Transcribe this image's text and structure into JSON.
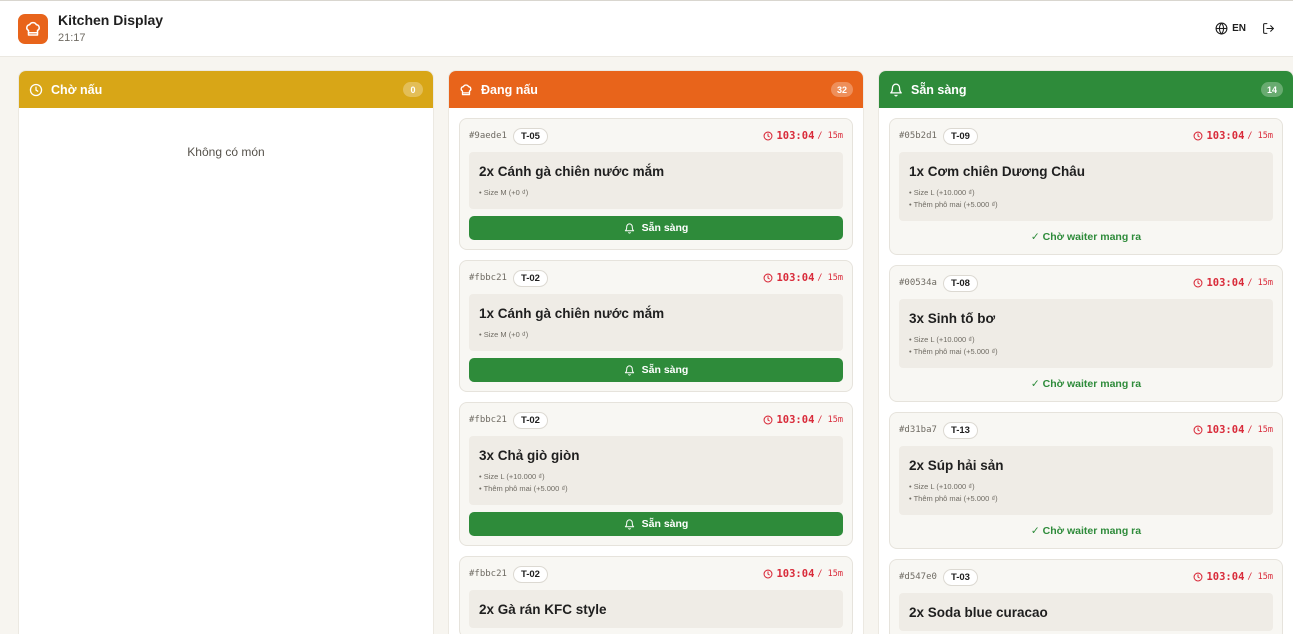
{
  "header": {
    "title": "Kitchen Display",
    "time": "21:17",
    "lang_label": "EN",
    "icons": {
      "logo": "chef-hat-icon",
      "lang": "globe-icon",
      "logout": "logout-icon"
    }
  },
  "colors": {
    "waiting": "#d8a617",
    "cooking": "#e8641b",
    "ready": "#2e8b3a",
    "timer": "#d92b3a"
  },
  "columns": {
    "waiting": {
      "label": "Chờ nấu",
      "count": "0",
      "empty_text": "Không có món",
      "icon": "clock-icon"
    },
    "cooking": {
      "label": "Đang nấu",
      "count": "32",
      "icon": "chef-hat-icon"
    },
    "ready": {
      "label": "Sẵn sàng",
      "count": "14",
      "icon": "bell-icon"
    }
  },
  "cooking_cards": [
    {
      "order_id": "#9aede1",
      "table": "T-05",
      "elapsed": "103:04",
      "limit": "/ 15m",
      "item": "2x Cánh gà chiên nước mắm",
      "mods": [
        "• Size M (+0 ₫)"
      ],
      "action": "Sẵn sàng"
    },
    {
      "order_id": "#fbbc21",
      "table": "T-02",
      "elapsed": "103:04",
      "limit": "/ 15m",
      "item": "1x Cánh gà chiên nước mắm",
      "mods": [
        "• Size M (+0 ₫)"
      ],
      "action": "Sẵn sàng"
    },
    {
      "order_id": "#fbbc21",
      "table": "T-02",
      "elapsed": "103:04",
      "limit": "/ 15m",
      "item": "3x Chả giò giòn",
      "mods": [
        "• Size L (+10.000 ₫)",
        "• Thêm phô mai (+5.000 ₫)"
      ],
      "action": "Sẵn sàng"
    },
    {
      "order_id": "#fbbc21",
      "table": "T-02",
      "elapsed": "103:04",
      "limit": "/ 15m",
      "item": "2x Gà rán KFC style",
      "mods": [],
      "action": ""
    }
  ],
  "ready_cards": [
    {
      "order_id": "#05b2d1",
      "table": "T-09",
      "elapsed": "103:04",
      "limit": "/ 15m",
      "item": "1x Cơm chiên Dương Châu",
      "mods": [
        "• Size L (+10.000 ₫)",
        "• Thêm phô mai (+5.000 ₫)"
      ],
      "status": "✓ Chờ waiter mang ra"
    },
    {
      "order_id": "#00534a",
      "table": "T-08",
      "elapsed": "103:04",
      "limit": "/ 15m",
      "item": "3x Sinh tố bơ",
      "mods": [
        "• Size L (+10.000 ₫)",
        "• Thêm phô mai (+5.000 ₫)"
      ],
      "status": "✓ Chờ waiter mang ra"
    },
    {
      "order_id": "#d31ba7",
      "table": "T-13",
      "elapsed": "103:04",
      "limit": "/ 15m",
      "item": "2x Súp hải sản",
      "mods": [
        "• Size L (+10.000 ₫)",
        "• Thêm phô mai (+5.000 ₫)"
      ],
      "status": "✓ Chờ waiter mang ra"
    },
    {
      "order_id": "#d547e0",
      "table": "T-03",
      "elapsed": "103:04",
      "limit": "/ 15m",
      "item": "2x Soda blue curacao",
      "mods": [],
      "status": ""
    }
  ]
}
